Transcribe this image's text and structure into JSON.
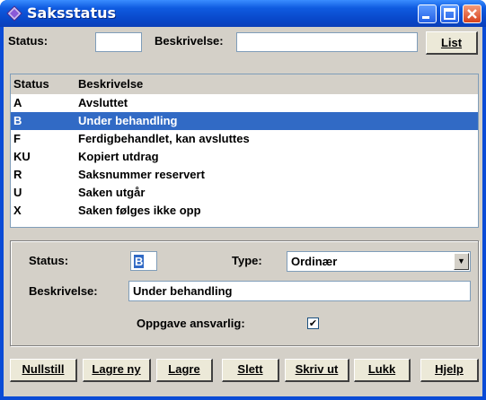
{
  "window": {
    "title": "Saksstatus"
  },
  "filter": {
    "status_label": "Status:",
    "status_value": "",
    "beskrivelse_label": "Beskrivelse:",
    "beskrivelse_value": "",
    "list_button": "List"
  },
  "list": {
    "headers": [
      "Status",
      "Beskrivelse"
    ],
    "rows": [
      {
        "status": "A",
        "beskrivelse": "Avsluttet",
        "selected": false
      },
      {
        "status": "B",
        "beskrivelse": "Under behandling",
        "selected": true
      },
      {
        "status": "F",
        "beskrivelse": "Ferdigbehandlet, kan avsluttes",
        "selected": false
      },
      {
        "status": "KU",
        "beskrivelse": "Kopiert utdrag",
        "selected": false
      },
      {
        "status": "R",
        "beskrivelse": "Saksnummer reservert",
        "selected": false
      },
      {
        "status": "U",
        "beskrivelse": "Saken utgår",
        "selected": false
      },
      {
        "status": "X",
        "beskrivelse": "Saken følges ikke opp",
        "selected": false
      }
    ],
    "selection_color": "#316ac5"
  },
  "detail": {
    "status_label": "Status:",
    "status_value": "B",
    "type_label": "Type:",
    "type_value": "Ordinær",
    "beskrivelse_label": "Beskrivelse:",
    "beskrivelse_value": "Under behandling",
    "oppgave_label": "Oppgave ansvarlig:",
    "oppgave_checked": true,
    "checkmark": "✔"
  },
  "buttons": {
    "nullstill": "Nullstill",
    "lagre_ny": "Lagre ny",
    "lagre": "Lagre",
    "slett": "Slett",
    "skriv_ut": "Skriv ut",
    "lukk": "Lukk",
    "hjelp": "Hjelp"
  }
}
